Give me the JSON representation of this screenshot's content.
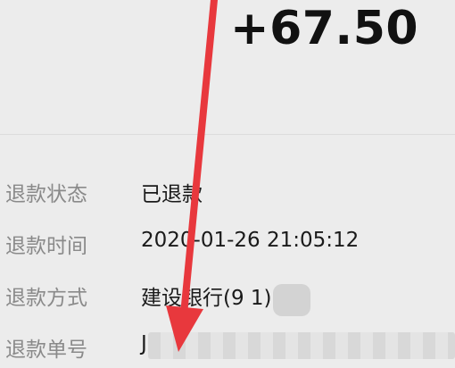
{
  "amount": "+67.50",
  "details": [
    {
      "label": "退款状态",
      "value": "已退款"
    },
    {
      "label": "退款时间",
      "value": "2020-01-26 21:05:12"
    },
    {
      "label": "退款方式",
      "value": "建设银行(9   1)"
    },
    {
      "label": "退款单号",
      "value": "J"
    }
  ],
  "annotation": {
    "color": "#e8383d"
  }
}
